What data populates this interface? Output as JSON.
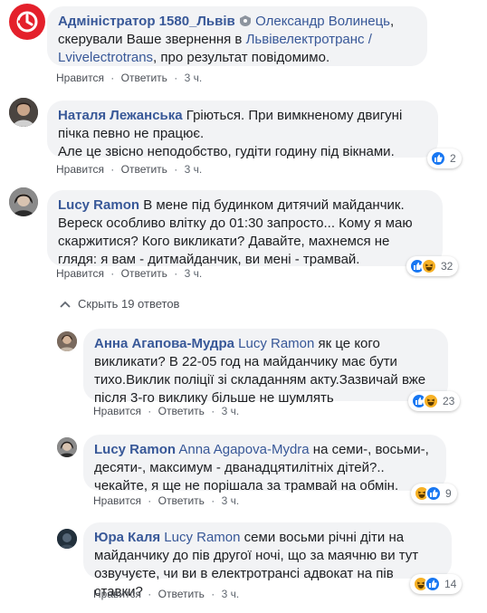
{
  "actions": {
    "like": "Нравится",
    "reply": "Ответить",
    "dot": "·"
  },
  "colors": {
    "link": "#385898",
    "bubble": "#f2f3f5",
    "like": "#1877f2",
    "haha": "#f7b125",
    "admin_avatar": "#e4202b"
  },
  "comments": [
    {
      "author": "Адміністратор 1580_Львів",
      "pre": "Олександр Волинець",
      "text": ", скерували Ваше звернення в ",
      "mention": "Львівелектротранс / Lvivelectrotrans",
      "text2": ", про результат повідомимо.",
      "time": "3 ч.",
      "avatar_icon": "org-logo-icon"
    },
    {
      "author": "Наталя Лежанська",
      "text": "Гріються. При вимкненому двигуні пічка певно не працює.",
      "text2": "Але це звісно неподобство, гудіти годину під вікнами.",
      "time": "3 ч.",
      "reaction_count": "2"
    },
    {
      "author": "Lucy Ramon",
      "text": "В мене під будинком дитячий майданчик. Вереск особливо влітку до 01:30 запросто... Кому я маю скаржитися? Кого викликати? Давайте, махнемся не глядя: я вам - дитмайданчик, ви мені - трамвай.",
      "time": "3 ч.",
      "reaction_count": "32"
    }
  ],
  "replies_toggle": "Скрыть 19 ответов",
  "replies": [
    {
      "author": "Анна Агапова-Мудра",
      "mention": "Lucy Ramon",
      "text": "як це кого викликати? В 22-05 год на майданчику має бути тихо.Виклик поліції зі складанням акту.Зазвичай вже після 3-го виклику більше не шумлять",
      "time": "3 ч.",
      "reaction_count": "23"
    },
    {
      "author": "Lucy Ramon",
      "mention": "Anna Agapova-Mydra",
      "text": "на семи-, восьми-, десяти-, максимум - дванадцятилітніх дітей?.. чекайте, я ще не порішала за трамвай на обмін.",
      "time": "3 ч.",
      "reaction_count": "9"
    },
    {
      "author": "Юра Каля",
      "mention": "Lucy Ramon",
      "text": "семи восьми річні діти на майданчику до пів другої ночі, що за маячню ви тут озвучуєте, чи ви в електротрансі адвокат на пів ставки?",
      "time": "3 ч.",
      "reaction_count": "14"
    }
  ]
}
